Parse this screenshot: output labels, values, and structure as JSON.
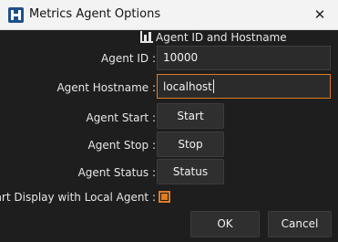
{
  "window": {
    "title": "Metrics Agent Options",
    "close_icon": "close-icon",
    "app_icon": "app-logo-icon"
  },
  "section": {
    "header": "Agent ID and Hostname",
    "header_icon": "bar-chart-icon"
  },
  "fields": {
    "agent_id_label": "Agent ID :",
    "agent_id_value": "10000",
    "hostname_label": "Agent Hostname :",
    "hostname_value": "localhost"
  },
  "actions": {
    "start_label": "Agent Start :",
    "start_button": "Start",
    "stop_label": "Agent Stop :",
    "stop_button": "Stop",
    "status_label": "Agent Status :",
    "status_button": "Status"
  },
  "options": {
    "start_display_label": "Start Display with Local Agent :",
    "start_display_checked": true
  },
  "footer": {
    "ok": "OK",
    "cancel": "Cancel"
  },
  "colors": {
    "accent": "#e07b24",
    "background": "#1e1e1e",
    "titlebar": "#f3f3f3"
  }
}
